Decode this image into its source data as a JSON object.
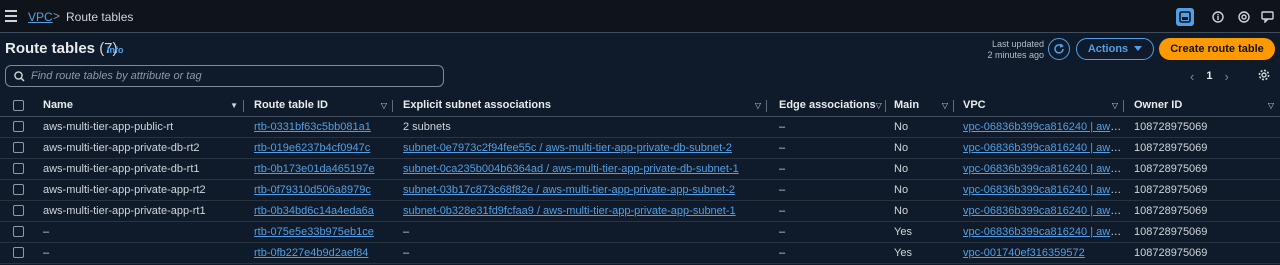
{
  "breadcrumb": {
    "vpc": "VPC",
    "separator": ">",
    "current": "Route tables"
  },
  "header": {
    "title": "Route tables",
    "count": "(7)",
    "info": "Info",
    "last_updated_1": "Last updated",
    "last_updated_2": "2 minutes ago",
    "refresh_icon": "refresh-icon",
    "actions_label": "Actions",
    "create_label": "Create route table"
  },
  "search": {
    "placeholder": "Find route tables by attribute or tag"
  },
  "pagination": {
    "page": "1",
    "prev": "‹",
    "next": "›"
  },
  "columns": [
    "Name",
    "Route table ID",
    "Explicit subnet associations",
    "Edge associations",
    "Main",
    "VPC",
    "Owner ID"
  ],
  "rows": [
    {
      "name": "aws-multi-tier-app-public-rt",
      "id": "rtb-0331bf63c5bb081a1",
      "subnets": "2 subnets",
      "subnets_link": false,
      "edge": "–",
      "main": "No",
      "vpc": "vpc-06836b399ca816240 | aws-...",
      "owner": "108728975069"
    },
    {
      "name": "aws-multi-tier-app-private-db-rt2",
      "id": "rtb-019e6237b4cf0947c",
      "subnets": "subnet-0e7973c2f94fee55c / aws-multi-tier-app-private-db-subnet-2",
      "subnets_link": true,
      "edge": "–",
      "main": "No",
      "vpc": "vpc-06836b399ca816240 | aws-...",
      "owner": "108728975069"
    },
    {
      "name": "aws-multi-tier-app-private-db-rt1",
      "id": "rtb-0b173e01da465197e",
      "subnets": "subnet-0ca235b004b6364ad / aws-multi-tier-app-private-db-subnet-1",
      "subnets_link": true,
      "edge": "–",
      "main": "No",
      "vpc": "vpc-06836b399ca816240 | aws-...",
      "owner": "108728975069"
    },
    {
      "name": "aws-multi-tier-app-private-app-rt2",
      "id": "rtb-0f79310d506a8979c",
      "subnets": "subnet-03b17c873c68f82e / aws-multi-tier-app-private-app-subnet-2",
      "subnets_link": true,
      "edge": "–",
      "main": "No",
      "vpc": "vpc-06836b399ca816240 | aws-...",
      "owner": "108728975069"
    },
    {
      "name": "aws-multi-tier-app-private-app-rt1",
      "id": "rtb-0b34bd6c14a4eda6a",
      "subnets": "subnet-0b328e31fd9fcfaa9 / aws-multi-tier-app-private-app-subnet-1",
      "subnets_link": true,
      "edge": "–",
      "main": "No",
      "vpc": "vpc-06836b399ca816240 | aws-...",
      "owner": "108728975069"
    },
    {
      "name": "–",
      "id": "rtb-075e5e33b975eb1ce",
      "subnets": "–",
      "subnets_link": false,
      "edge": "–",
      "main": "Yes",
      "vpc": "vpc-06836b399ca816240 | aws-...",
      "owner": "108728975069"
    },
    {
      "name": "–",
      "id": "rtb-0fb227e4b9d2aef84",
      "subnets": "–",
      "subnets_link": false,
      "edge": "–",
      "main": "Yes",
      "vpc": "vpc-001740ef316359572",
      "owner": "108728975069"
    }
  ],
  "colors": {
    "accent": "#539fe5",
    "primary_button": "#ff9900",
    "background": "#0f1b2a"
  }
}
